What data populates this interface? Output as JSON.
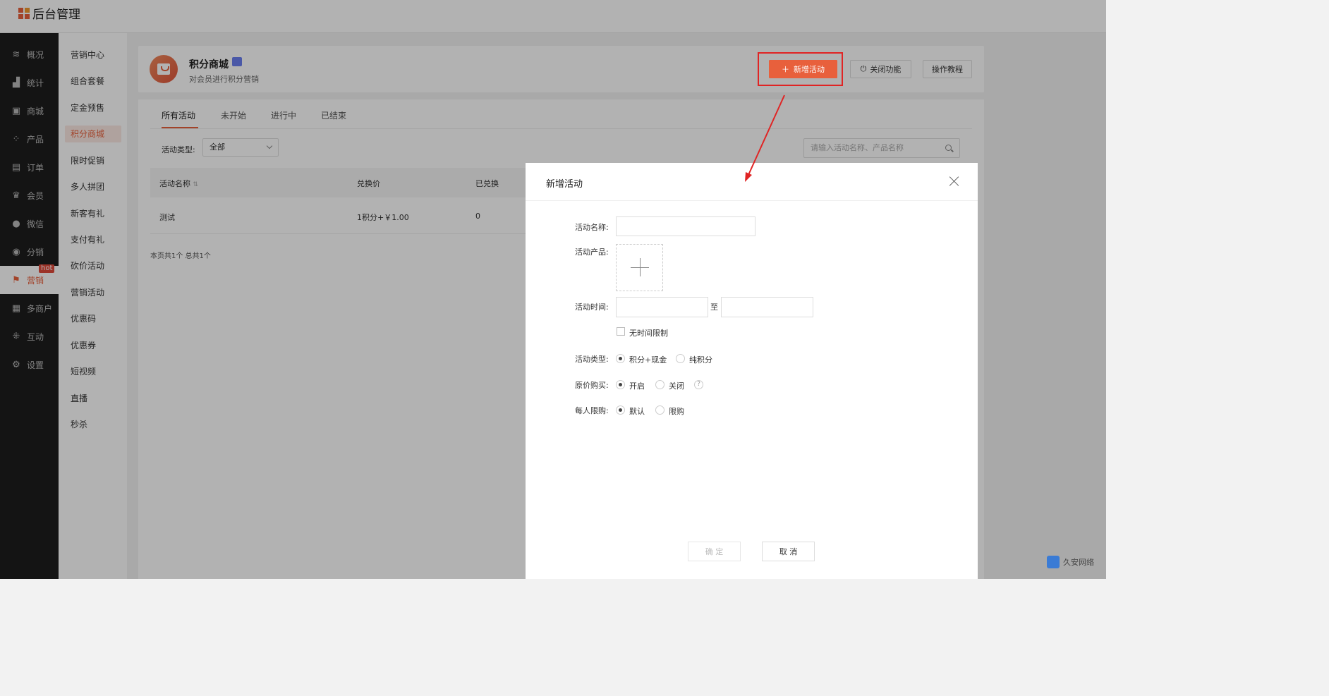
{
  "app": {
    "title": "后台管理"
  },
  "nav_primary": [
    {
      "label": "概况",
      "icon": "layers-icon"
    },
    {
      "label": "统计",
      "icon": "chart-icon"
    },
    {
      "label": "商城",
      "icon": "shop-icon"
    },
    {
      "label": "产品",
      "icon": "grid-icon"
    },
    {
      "label": "订单",
      "icon": "clipboard-icon"
    },
    {
      "label": "会员",
      "icon": "crown-icon"
    },
    {
      "label": "微信",
      "icon": "chat-icon"
    },
    {
      "label": "分销",
      "icon": "users-icon"
    },
    {
      "label": "营销",
      "icon": "flag-icon",
      "active": true,
      "badge": "hot"
    },
    {
      "label": "多商户",
      "icon": "store-icon"
    },
    {
      "label": "互动",
      "icon": "apps-icon"
    },
    {
      "label": "设置",
      "icon": "gear-icon"
    }
  ],
  "nav_secondary": [
    {
      "label": "营销中心"
    },
    {
      "label": "组合套餐"
    },
    {
      "label": "定金预售"
    },
    {
      "label": "积分商城",
      "active": true
    },
    {
      "label": "限时促销"
    },
    {
      "label": "多人拼团"
    },
    {
      "label": "新客有礼"
    },
    {
      "label": "支付有礼"
    },
    {
      "label": "砍价活动"
    },
    {
      "label": "营销活动"
    },
    {
      "label": "优惠码"
    },
    {
      "label": "优惠券"
    },
    {
      "label": "短视频"
    },
    {
      "label": "直播"
    },
    {
      "label": "秒杀"
    }
  ],
  "header": {
    "title": "积分商城",
    "subtitle": "对会员进行积分营销",
    "add_button": "新增活动",
    "close_button": "关闭功能",
    "tutorial_button": "操作教程"
  },
  "tabs": [
    "所有活动",
    "未开始",
    "进行中",
    "已结束"
  ],
  "filter": {
    "label": "活动类型:",
    "value": "全部",
    "search_placeholder": "请输入活动名称、产品名称"
  },
  "table": {
    "columns": [
      "活动名称",
      "兑换价",
      "已兑换"
    ],
    "rows": [
      {
        "name": "测试",
        "price": "1积分+￥1.00",
        "redeemed": "0"
      }
    ],
    "pager": "本页共1个 总共1个"
  },
  "dialog": {
    "title": "新增活动",
    "name_label": "活动名称:",
    "product_label": "活动产品:",
    "time_label": "活动时间:",
    "time_to": "至",
    "no_time_limit": "无时间限制",
    "type_label": "活动类型:",
    "type_options": [
      "积分+现金",
      "纯积分"
    ],
    "original_label": "原价购买:",
    "original_options": [
      "开启",
      "关闭"
    ],
    "limit_label": "每人限购:",
    "limit_options": [
      "默认",
      "限购"
    ],
    "confirm": "确 定",
    "cancel": "取 消"
  },
  "watermark": {
    "text": "久安网络"
  },
  "colors": {
    "accent": "#e8603c",
    "highlight": "#e02424"
  }
}
